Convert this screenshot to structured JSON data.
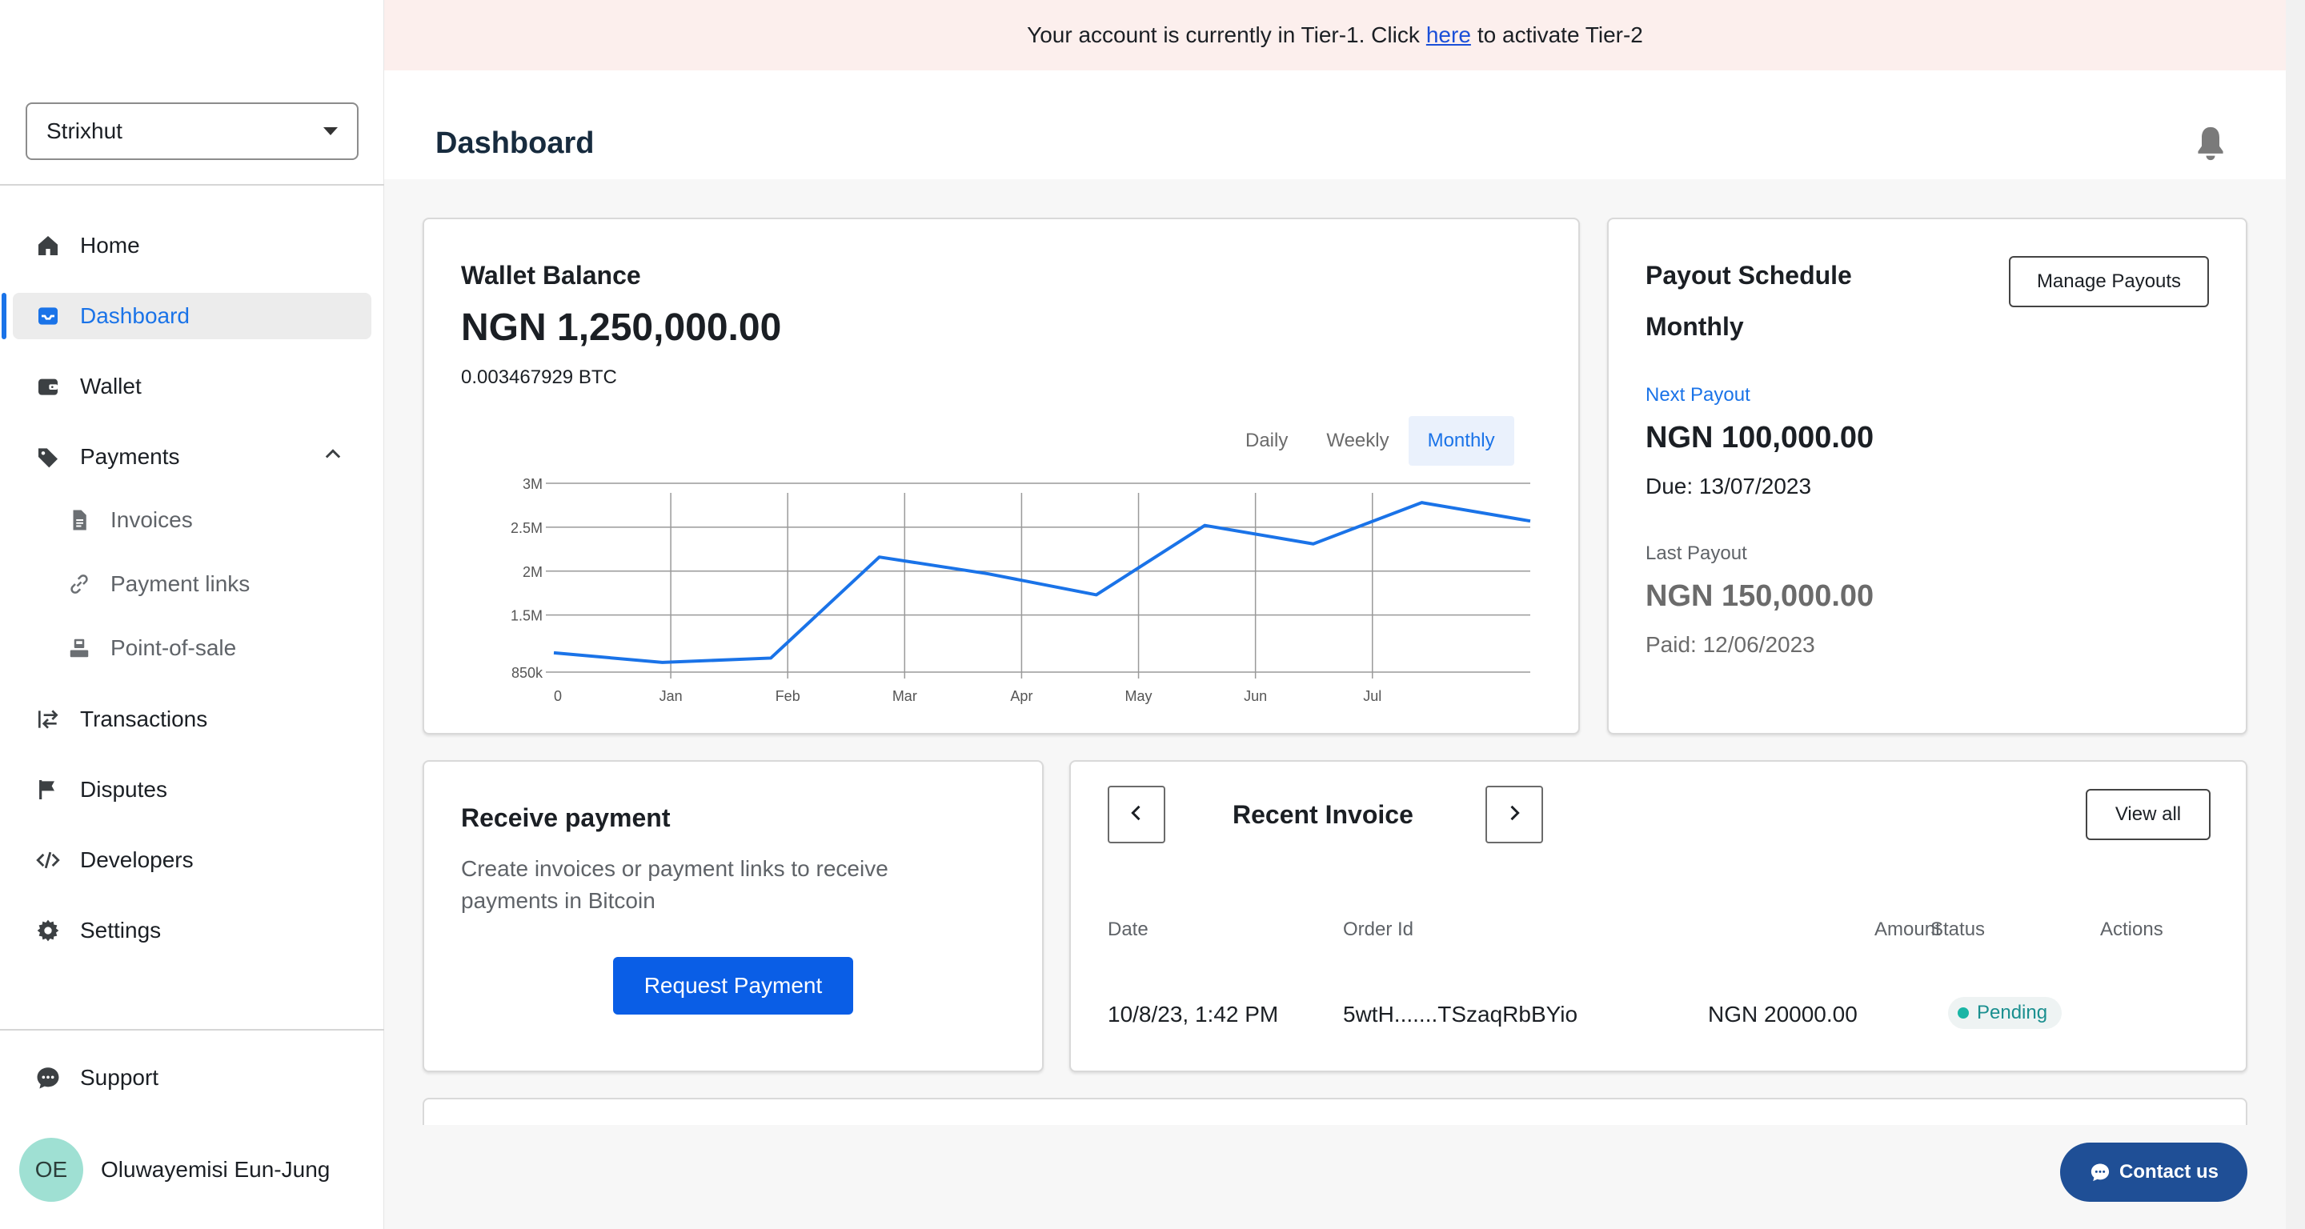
{
  "sidebar": {
    "business": "Strixhut",
    "items": [
      {
        "label": "Home"
      },
      {
        "label": "Dashboard"
      },
      {
        "label": "Wallet"
      },
      {
        "label": "Payments"
      },
      {
        "label": "Invoices"
      },
      {
        "label": "Payment links"
      },
      {
        "label": "Point-of-sale"
      },
      {
        "label": "Transactions"
      },
      {
        "label": "Disputes"
      },
      {
        "label": "Developers"
      },
      {
        "label": "Settings"
      }
    ],
    "support": "Support",
    "user": {
      "initials": "OE",
      "name": "Oluwayemisi Eun-Jung"
    }
  },
  "banner": {
    "before": "Your account is currently in Tier-1. Click",
    "link": "here",
    "after": "to activate Tier-2"
  },
  "header": {
    "title": "Dashboard"
  },
  "wallet": {
    "title": "Wallet Balance",
    "amount": "NGN 1,250,000.00",
    "btc": "0.003467929 BTC",
    "tabs": [
      "Daily",
      "Weekly",
      "Monthly"
    ],
    "active_tab": "Monthly"
  },
  "chart_data": {
    "type": "line",
    "x_ticks": [
      "0",
      "Jan",
      "Feb",
      "Mar",
      "Apr",
      "May",
      "Jun",
      "Jul"
    ],
    "y_ticks": [
      "850k",
      "1.5M",
      "2M",
      "2.5M",
      "3M"
    ],
    "series": [
      {
        "values": [
          1070000,
          960000,
          1010000,
          2160000,
          1970000,
          1730000,
          2520000,
          2310000,
          2780000,
          2570000
        ]
      }
    ],
    "grid": true,
    "colors": {
      "line": "#1a73e8",
      "grid": "#9a9a9a"
    }
  },
  "payout": {
    "title": "Payout Schedule",
    "manage_label": "Manage Payouts",
    "frequency": "Monthly",
    "next_label": "Next Payout",
    "next_amount": "NGN 100,000.00",
    "due": "Due: 13/07/2023",
    "last_label": "Last Payout",
    "last_amount": "NGN 150,000.00",
    "paid": "Paid: 12/06/2023"
  },
  "receive": {
    "title": "Receive payment",
    "description_line1": "Create invoices or payment links to receive",
    "description_line2": "payments in Bitcoin",
    "button": "Request Payment"
  },
  "invoice": {
    "title": "Recent Invoice",
    "view_all": "View all",
    "columns": [
      "Date",
      "Order Id",
      "Amount",
      "Status",
      "Actions"
    ],
    "rows": [
      {
        "date": "10/8/23, 1:42 PM",
        "order_id": "5wtH.......TSzaqRbBYio",
        "amount": "NGN 20000.00",
        "status": "Pending"
      }
    ]
  },
  "contact": {
    "label": "Contact us"
  }
}
